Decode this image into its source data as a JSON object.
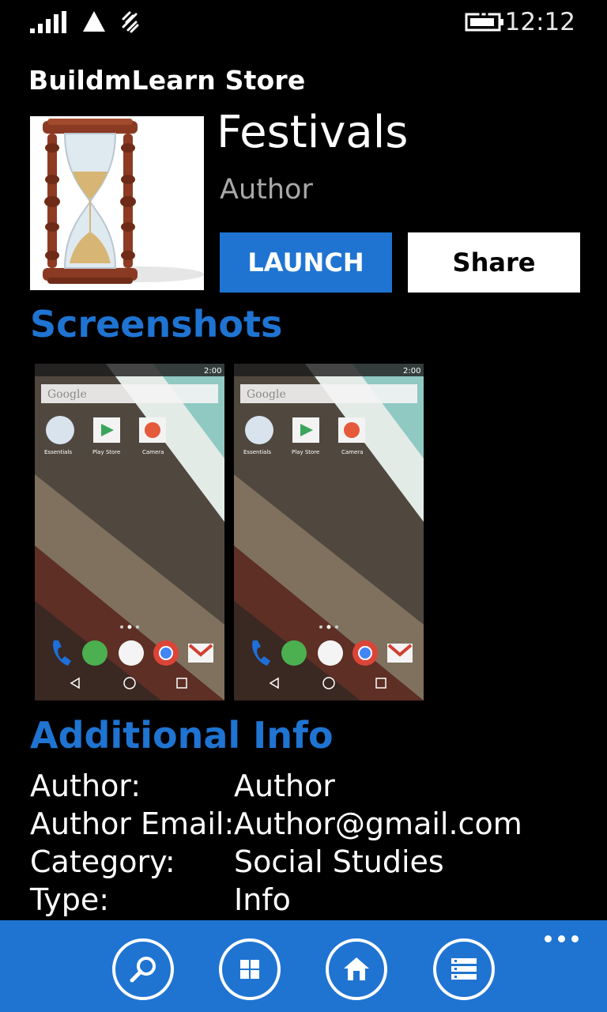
{
  "status_bar": {
    "time": "12:12"
  },
  "app_title": "BuildmLearn Store",
  "app": {
    "name": "Festivals",
    "author": "Author",
    "launch_label": "LAUNCH",
    "share_label": "Share"
  },
  "screenshots": {
    "heading": "Screenshots",
    "items": [
      {
        "search_text": "Google",
        "status_time": "2:00",
        "app_labels": [
          "Essentials",
          "Play Store",
          "Camera"
        ]
      },
      {
        "search_text": "Google",
        "status_time": "2:00",
        "app_labels": [
          "Essentials",
          "Play Store",
          "Camera"
        ]
      }
    ]
  },
  "additional_info": {
    "heading": "Additional Info",
    "rows": [
      {
        "label": "Author:",
        "value": "Author"
      },
      {
        "label": "Author Email:",
        "value": "Author@gmail.com"
      },
      {
        "label": "Category:",
        "value": "Social Studies"
      },
      {
        "label": "Type:",
        "value": "Info"
      }
    ]
  },
  "app_bar": {
    "buttons": [
      "search-icon",
      "apps-grid-icon",
      "home-icon",
      "list-icon"
    ],
    "more": "more-icon"
  },
  "colors": {
    "accent": "#1f74d2",
    "background": "#000000"
  }
}
